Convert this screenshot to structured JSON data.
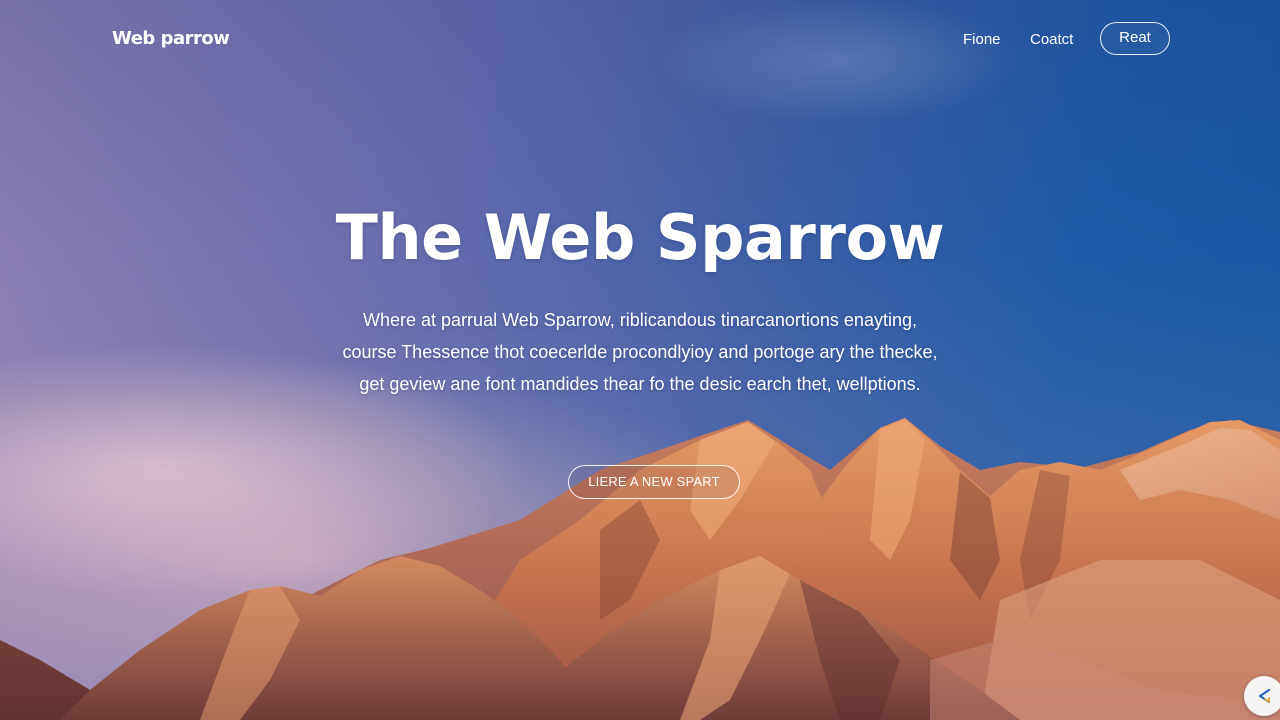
{
  "header": {
    "brand": "Web parrow",
    "nav": {
      "home_label": "Fione",
      "contact_label": "Coatct",
      "button_label": "Reat"
    }
  },
  "hero": {
    "title": "The Web Sparrow",
    "description": "Where at parrual Web Sparrow, riblicandous tinarcanortions enayting, course Thessence thot coecerlde procondlyioy and portoge ary the thecke, get geview ane font mandides thear fo the desic earch thet, wellptions.",
    "cta_label": "LIERE A NEW SPART"
  },
  "floating_button": {
    "icon": "chat-icon"
  },
  "colors": {
    "sky_top_right": "#1a57a4",
    "sky_left": "#8c7fb4",
    "mountain_light": "#d98a5f",
    "mountain_shadow": "#7a3f36"
  }
}
